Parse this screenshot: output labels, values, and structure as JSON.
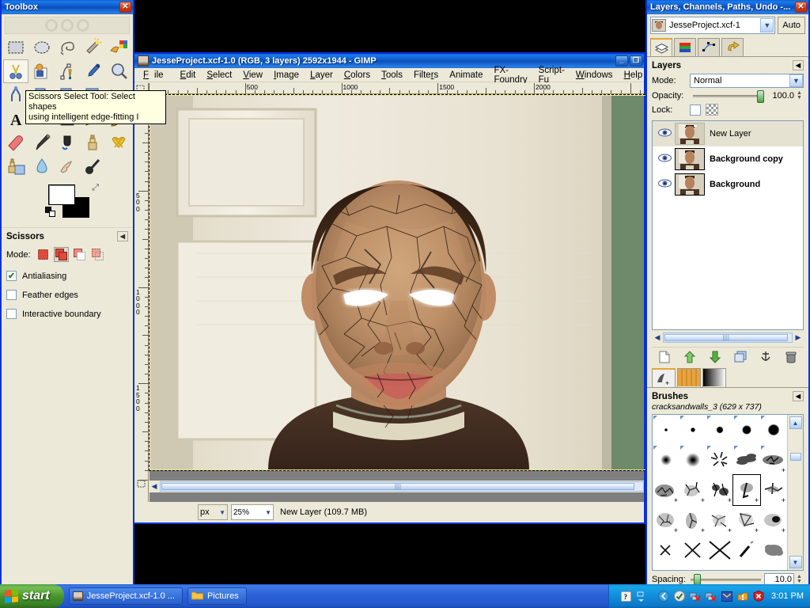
{
  "toolbox": {
    "title": "Toolbox",
    "close_label": "✕",
    "tools": [
      {
        "name": "rect-select-tool",
        "label": "Rectangle Select"
      },
      {
        "name": "ellipse-select-tool",
        "label": "Ellipse Select"
      },
      {
        "name": "free-select-tool",
        "label": "Free Select (Lasso)"
      },
      {
        "name": "fuzzy-select-tool",
        "label": "Fuzzy Select (Magic Wand)"
      },
      {
        "name": "by-color-select-tool",
        "label": "Select by Color"
      },
      {
        "name": "scissors-select-tool",
        "label": "Scissors Select"
      },
      {
        "name": "foreground-select-tool",
        "label": "Foreground Select"
      },
      {
        "name": "paths-tool",
        "label": "Paths"
      },
      {
        "name": "color-picker-tool",
        "label": "Color Picker"
      },
      {
        "name": "zoom-tool",
        "label": "Zoom"
      },
      {
        "name": "measure-tool",
        "label": "Measure"
      },
      {
        "name": "move-tool",
        "label": "Move"
      },
      {
        "name": "align-tool",
        "label": "Alignment"
      },
      {
        "name": "crop-tool",
        "label": "Crop"
      },
      {
        "name": "flip-tool",
        "label": "Flip"
      },
      {
        "name": "text-tool",
        "label": "Text"
      },
      {
        "name": "bucket-fill-tool",
        "label": "Bucket Fill"
      },
      {
        "name": "gradient-tool",
        "label": "Blend / Gradient"
      },
      {
        "name": "pencil-tool",
        "label": "Pencil"
      },
      {
        "name": "paintbrush-tool",
        "label": "Paintbrush"
      },
      {
        "name": "eraser-tool",
        "label": "Eraser"
      },
      {
        "name": "airbrush-tool",
        "label": "Airbrush"
      },
      {
        "name": "ink-tool",
        "label": "Ink"
      },
      {
        "name": "clone-tool",
        "label": "Clone"
      },
      {
        "name": "heal-tool",
        "label": "Heal"
      },
      {
        "name": "perspective-clone-tool",
        "label": "Perspective Clone"
      },
      {
        "name": "blur-sharpen-tool",
        "label": "Blur / Sharpen"
      },
      {
        "name": "smudge-tool",
        "label": "Smudge"
      },
      {
        "name": "dodge-burn-tool",
        "label": "Dodge / Burn"
      }
    ],
    "active_tool_index": 5,
    "foreground_color": "#ffffff",
    "background_color": "#000000",
    "options": {
      "title": "Scissors",
      "mode_label": "Mode:",
      "modes": [
        "replace",
        "add",
        "subtract",
        "intersect"
      ],
      "selected_mode_index": 1,
      "checkboxes": [
        {
          "label": "Antialiasing",
          "checked": true
        },
        {
          "label": "Feather edges",
          "checked": false
        },
        {
          "label": "Interactive boundary",
          "checked": false
        }
      ]
    }
  },
  "tooltip": {
    "line1": "Scissors Select Tool: Select shapes",
    "line2": "using intelligent edge-fitting  I"
  },
  "image_window": {
    "title": "JesseProject.xcf-1.0 (RGB, 3 layers) 2592x1944 - GIMP",
    "minimize_label": "_",
    "maximize_label": "❐",
    "menus": [
      "File",
      "Edit",
      "Select",
      "View",
      "Image",
      "Layer",
      "Colors",
      "Tools",
      "Filters",
      "Animate",
      "FX-Foundry",
      "Script-Fu",
      "Windows",
      "Help"
    ],
    "ruler_h_labels": [
      "500",
      "1000",
      "1500",
      "2000"
    ],
    "ruler_v_labels": [
      "500",
      "1000",
      "1500"
    ],
    "status": {
      "unit": "px",
      "zoom": "25%",
      "text": "New Layer (109.7 MB)"
    }
  },
  "dock": {
    "title": "Layers, Channels, Paths, Undo -...",
    "close_label": "✕",
    "image_name": "JesseProject.xcf-1",
    "auto_label": "Auto",
    "tabs": [
      {
        "name": "layers-tab",
        "label": "Layers"
      },
      {
        "name": "channels-tab",
        "label": "Channels"
      },
      {
        "name": "paths-tab",
        "label": "Paths"
      },
      {
        "name": "undo-tab",
        "label": "Undo History"
      }
    ],
    "active_tab_index": 0,
    "layers_panel": {
      "title": "Layers",
      "mode_label": "Mode:",
      "mode_value": "Normal",
      "opacity_label": "Opacity:",
      "opacity_value": "100.0",
      "lock_label": "Lock:",
      "layers": [
        {
          "name": "New Layer",
          "visible": true,
          "selected": true,
          "bold": false
        },
        {
          "name": "Background copy",
          "visible": true,
          "selected": false,
          "bold": true
        },
        {
          "name": "Background",
          "visible": true,
          "selected": false,
          "bold": true
        }
      ],
      "buttons": [
        {
          "name": "new-layer-button",
          "glyph": "📄"
        },
        {
          "name": "raise-layer-button",
          "glyph": "⬆"
        },
        {
          "name": "lower-layer-button",
          "glyph": "⬇"
        },
        {
          "name": "duplicate-layer-button",
          "glyph": "❐"
        },
        {
          "name": "anchor-layer-button",
          "glyph": "⚓"
        },
        {
          "name": "delete-layer-button",
          "glyph": "🗑"
        }
      ]
    },
    "brushes_panel": {
      "title": "Brushes",
      "selected_brush": "cracksandwalls_3 (629 x 737)",
      "spacing_label": "Spacing:",
      "spacing_value": "10.0",
      "tabs": [
        {
          "name": "brushes-tab",
          "label": "Brushes"
        },
        {
          "name": "patterns-tab",
          "label": "Patterns"
        },
        {
          "name": "gradients-tab",
          "label": "Gradients"
        }
      ],
      "active_tab_index": 0,
      "selected_cell_index": 13
    }
  },
  "taskbar": {
    "start_label": "start",
    "items": [
      {
        "name": "taskbar-item-gimp",
        "label": "JesseProject.xcf-1.0 ..."
      },
      {
        "name": "taskbar-item-pictures",
        "label": "Pictures"
      }
    ],
    "tray": {
      "time": "3:01 PM",
      "icons": [
        "show-desktop-icon",
        "updates-icon",
        "network-disconnected-icon",
        "network-disconnected-2-icon",
        "messenger-icon",
        "warning-icon",
        "security-alert-icon"
      ]
    }
  },
  "colors": {
    "title_blue": "#0a55c4",
    "face_skin": "#c69878",
    "accent_orange": "#e8a33d"
  }
}
